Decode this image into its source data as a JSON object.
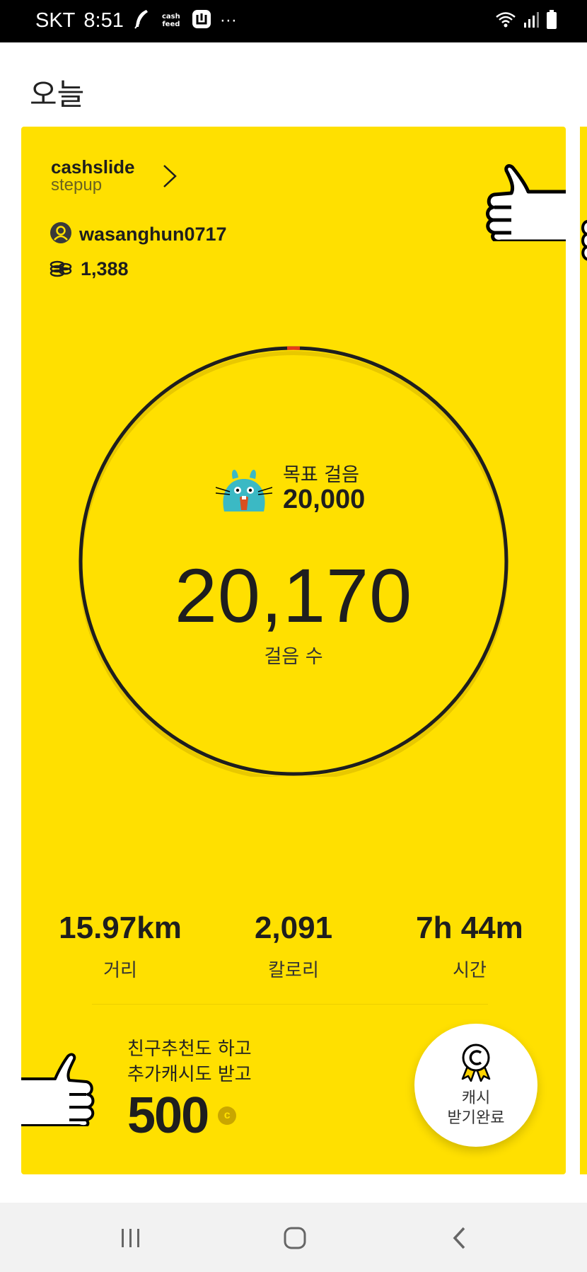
{
  "status_bar": {
    "carrier": "SKT",
    "time": "8:51",
    "cash_feed_label": "cash feed",
    "more": "···",
    "icons": [
      "feather-icon",
      "cashfeed-icon",
      "app-badge-icon",
      "wifi-icon",
      "signal-icon",
      "battery-icon"
    ]
  },
  "page": {
    "title": "오늘"
  },
  "card": {
    "brand_name": "cashslide",
    "brand_sub": "stepup",
    "username": "wasanghun0717",
    "coins": "1,388",
    "goal_label": "목표 걸음",
    "goal_value": "20,000",
    "steps": "20,170",
    "steps_label": "걸음 수",
    "stats": [
      {
        "value": "15.97km",
        "label": "거리"
      },
      {
        "value": "2,091",
        "label": "칼로리"
      },
      {
        "value": "7h 44m",
        "label": "시간"
      }
    ],
    "promo_line1": "친구추천도 하고",
    "promo_line2": "추가캐시도 받고",
    "promo_amount": "500",
    "promo_coin_symbol": "c",
    "reward_line1": "캐시",
    "reward_line2": "받기완료",
    "colors": {
      "background": "#ffe000",
      "ring": "#1e1e1e",
      "progress_marker": "#e53b1a",
      "mascot": "#3bb9c4"
    }
  },
  "nav": {
    "icons": [
      "recent-apps-icon",
      "home-icon",
      "back-icon"
    ]
  }
}
